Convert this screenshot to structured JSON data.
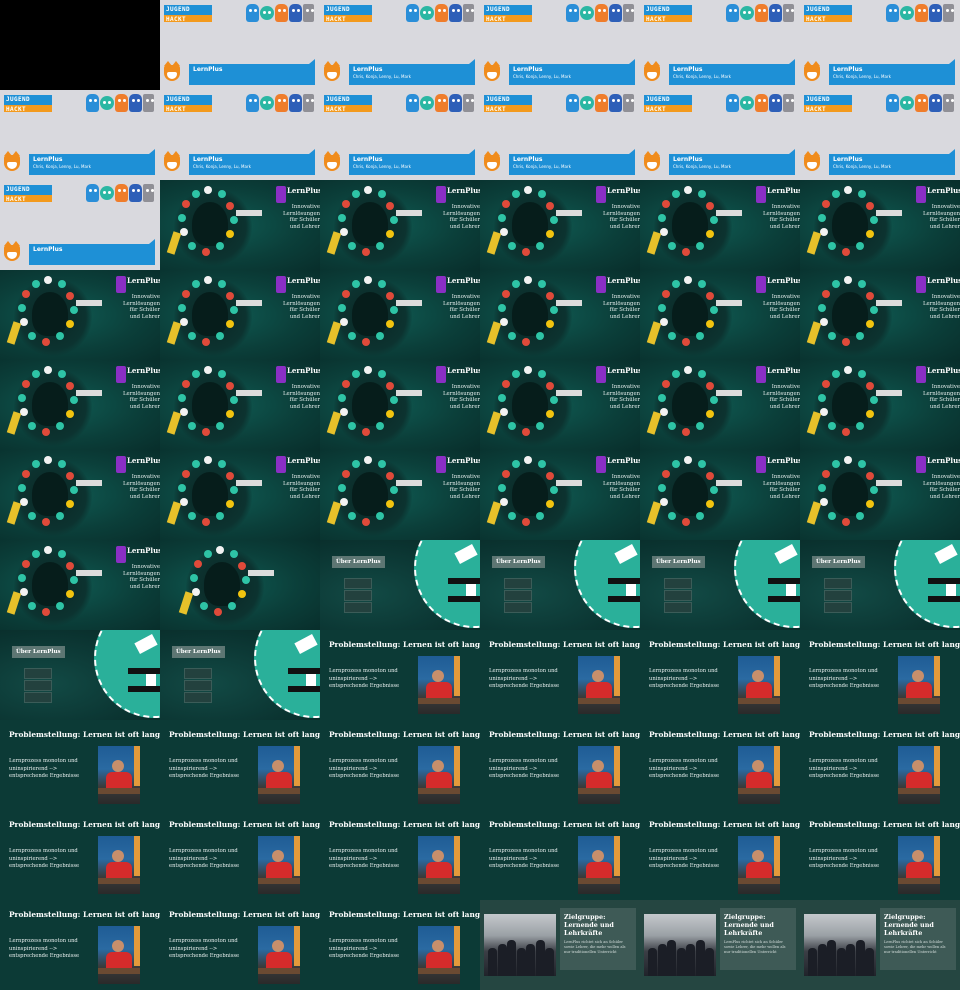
{
  "slides": {
    "jugend_hackt": {
      "logo_text": "JUGEND HACKT",
      "project_title": "LernPlus",
      "team": "Chris, Konja, Lenny, Lu, Mark"
    },
    "lernplus_network": {
      "name": "LernPlus",
      "tagline": "Innovative Lernlösungen für Schüler und Lehrer"
    },
    "ueber": {
      "title": "Über LernPlus"
    },
    "problem": {
      "title": "Problemstellung: Lernen ist oft langweilig",
      "body": "Lernprozess monoton und uninspirierend --> entsprechende Ergebnisse"
    },
    "zielgruppe": {
      "title": "Zielgruppe: Lernende und Lehrkräfte",
      "body": "LernPlus richtet sich an Schüler sowie Lehrer, die mehr wollen als nur traditionellen Unterricht"
    }
  },
  "colors": {
    "jh_background": "#d9d9de",
    "jh_blue": "#1e90d6",
    "jh_orange": "#f39a1d",
    "teal_dark": "#0c3a36",
    "teal_accent": "#2ab09a"
  },
  "icons": {
    "jh_mascots": [
      "blue-robot-icon",
      "teal-robot-icon",
      "orange-robot-icon",
      "navy-robot-icon",
      "grey-robot-icon"
    ],
    "jh_fox": "fox-mascot-icon",
    "lernplus_logo": "lernplus-logo-icon"
  }
}
